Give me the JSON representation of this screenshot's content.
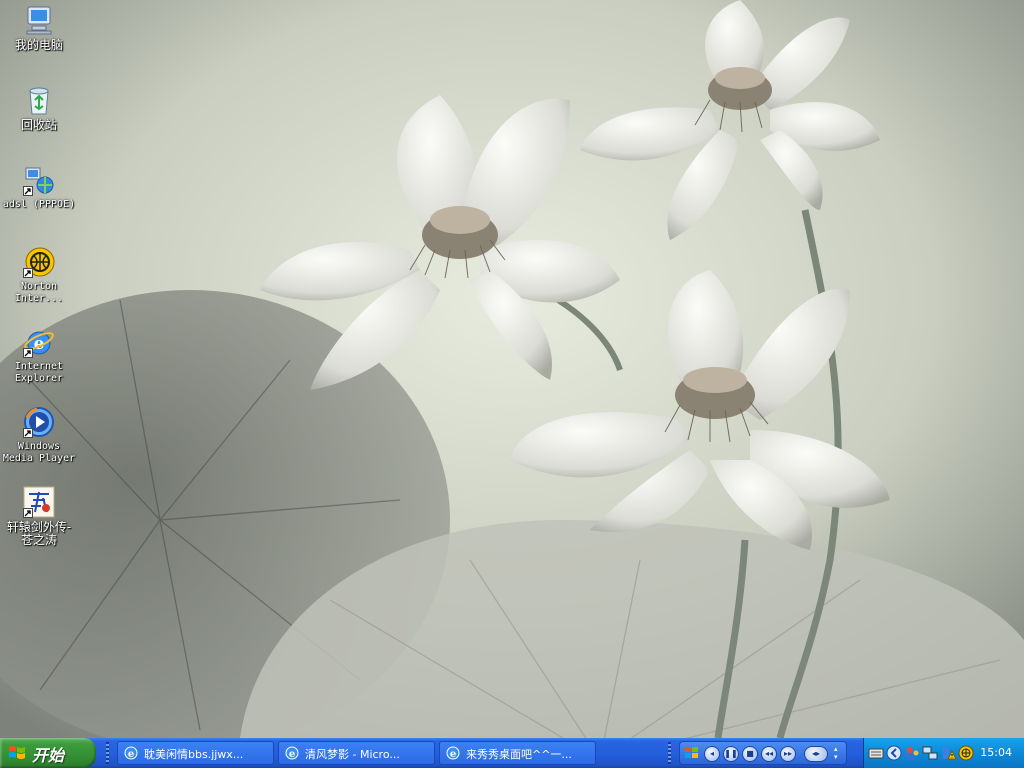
{
  "desktop": {
    "icons": [
      {
        "label": "我的电脑",
        "icon": "my-computer-icon"
      },
      {
        "label": "回收站",
        "icon": "recycle-bin-icon"
      },
      {
        "label": "adsl (PPPOE)",
        "icon": "network-connection-icon"
      },
      {
        "label": "Norton Inter...",
        "icon": "norton-internet-security-icon"
      },
      {
        "label": "Internet Explorer",
        "icon": "internet-explorer-icon"
      },
      {
        "label": "Windows Media Player",
        "icon": "windows-media-player-icon"
      },
      {
        "label": "轩辕剑外传-苍之涛",
        "icon": "game-shortcut-icon"
      }
    ]
  },
  "taskbar": {
    "start_label": "开始",
    "tasks": [
      {
        "title": "耽美闲情bbs.jjwx...",
        "icon": "ie-page-icon"
      },
      {
        "title": "清风梦影 - Micro...",
        "icon": "ie-page-icon"
      },
      {
        "title": "来秀秀桌面吧^^一...",
        "icon": "ie-page-icon"
      }
    ],
    "media_controls": [
      "previous",
      "pause",
      "stop",
      "rewind",
      "fast-forward",
      "volume"
    ],
    "clock": "15:04",
    "colors": {
      "taskbar": "#245edb",
      "start": "#3c9d3c",
      "tray": "#0e8ad7"
    }
  }
}
